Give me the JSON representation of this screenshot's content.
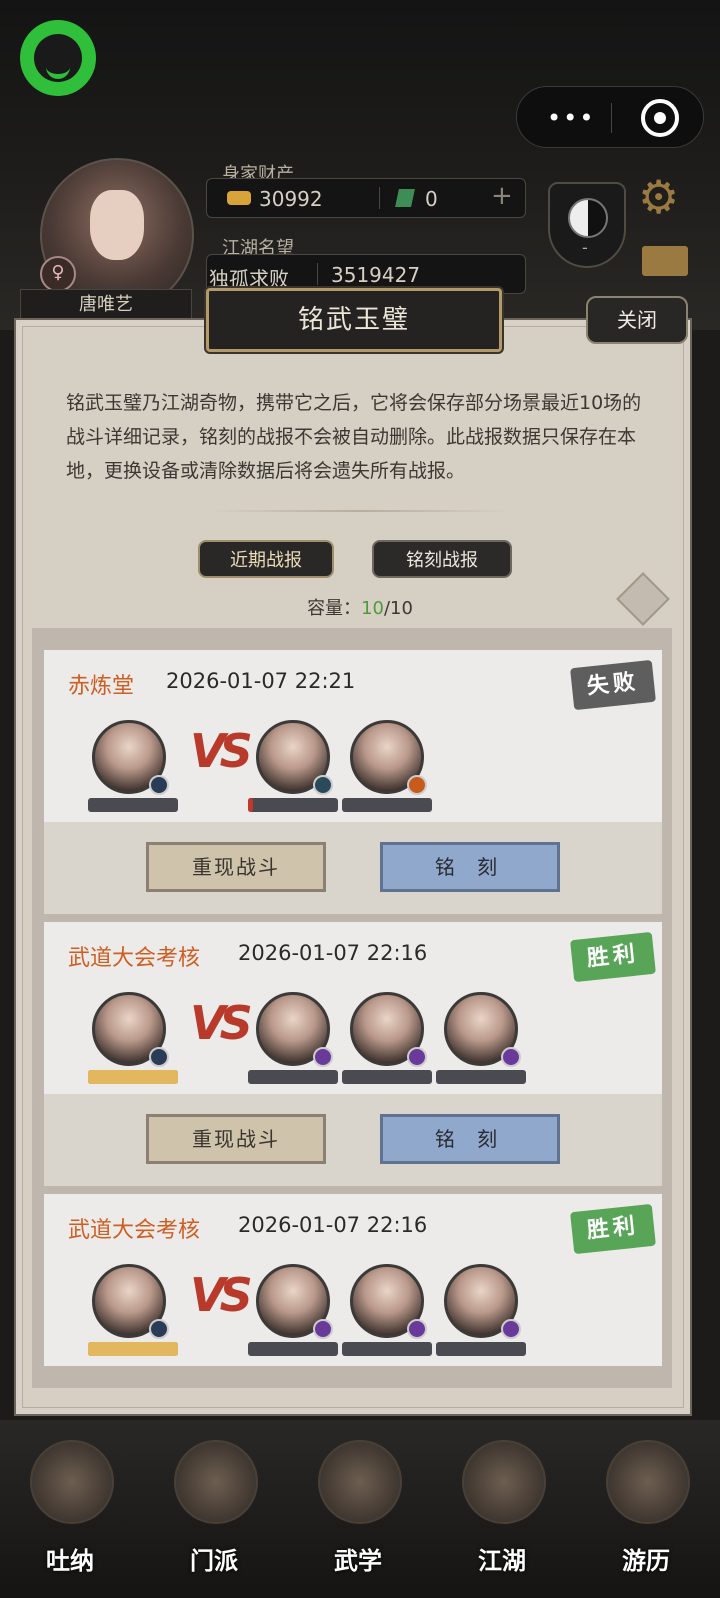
{
  "header": {
    "wealth_label": "身家财产",
    "gold_amount": "30992",
    "jade_amount": "0",
    "plus_symbol": "+",
    "fame_label": "江湖名望",
    "fame_title": "独孤求败",
    "fame_value": "3519427",
    "player_name": "唐唯艺",
    "gender_symbol": "♀",
    "emblem_label": "-"
  },
  "capsule": {
    "dots": "•••"
  },
  "panel": {
    "title": "铭武玉璧",
    "close_label": "关闭",
    "description": "铭武玉璧乃江湖奇物，携带它之后，它将会保存部分场景最近10场的战斗详细记录，铭刻的战报不会被自动删除。此战报数据只保存在本地，更换设备或清除数据后将会遗失所有战报。",
    "tabs": [
      "近期战报",
      "铭刻战报"
    ],
    "capacity_label": "容量：",
    "capacity_used": "10",
    "capacity_total": "/10"
  },
  "battles": [
    {
      "scene": "赤炼堂",
      "time": "2026-01-07 22:21",
      "result": "失败",
      "vs": "VS",
      "replay": "重现战斗",
      "engrave": "铭 刻",
      "self_hp": 0,
      "enemy_hp": [
        0.06,
        0
      ]
    },
    {
      "scene": "武道大会考核",
      "time": "2026-01-07 22:16",
      "result": "胜利",
      "vs": "VS",
      "replay": "重现战斗",
      "engrave": "铭 刻",
      "self_hp": 1,
      "enemy_hp": [
        0,
        0,
        0
      ]
    },
    {
      "scene": "武道大会考核",
      "time": "2026-01-07 22:16",
      "result": "胜利",
      "vs": "VS",
      "self_hp": 1,
      "enemy_hp": [
        0,
        0,
        0
      ]
    }
  ],
  "nav": [
    "吐纳",
    "门派",
    "武学",
    "江湖",
    "游历"
  ],
  "colors": {
    "win": "#59a558",
    "lose": "#5e5e5e",
    "scene": "#cf5e23",
    "hp_self": "#e2b75d",
    "hp_enemy": "#c0392b"
  }
}
